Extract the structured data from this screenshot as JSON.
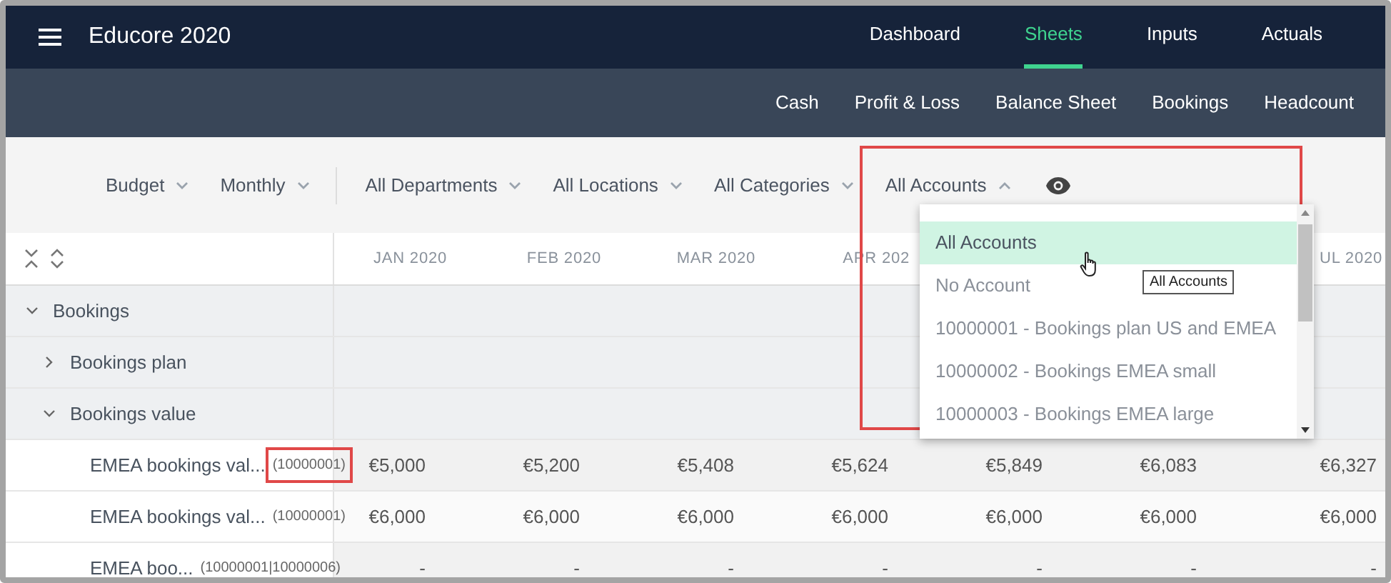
{
  "app": {
    "title": "Educore 2020"
  },
  "nav_tabs": [
    {
      "label": "Dashboard",
      "selected": false
    },
    {
      "label": "Sheets",
      "selected": true
    },
    {
      "label": "Inputs",
      "selected": false
    },
    {
      "label": "Actuals",
      "selected": false
    }
  ],
  "sub_tabs": [
    {
      "label": "Cash",
      "selected": false
    },
    {
      "label": "Profit & Loss",
      "selected": false
    },
    {
      "label": "Balance Sheet",
      "selected": false
    },
    {
      "label": "Bookings",
      "selected": false
    },
    {
      "label": "Headcount",
      "selected": false
    }
  ],
  "filters": [
    {
      "label": "Budget",
      "open": false,
      "highlighted": false
    },
    {
      "label": "Monthly",
      "open": false,
      "highlighted": false
    },
    {
      "label": "All Departments",
      "open": false,
      "highlighted": false
    },
    {
      "label": "All Locations",
      "open": false,
      "highlighted": false
    },
    {
      "label": "All Categories",
      "open": false,
      "highlighted": false
    },
    {
      "label": "All Accounts",
      "open": true,
      "highlighted": true
    }
  ],
  "dropdown": {
    "items": [
      {
        "label": "All Accounts",
        "selected": true
      },
      {
        "label": "No Account",
        "selected": false
      },
      {
        "label": "10000001 - Bookings plan US and EMEA",
        "selected": false
      },
      {
        "label": "10000002 - Bookings EMEA small",
        "selected": false
      },
      {
        "label": "10000003 - Bookings EMEA large",
        "selected": false
      }
    ],
    "tooltip": "All Accounts"
  },
  "table": {
    "columns": [
      {
        "label": "JAN 2020"
      },
      {
        "label": "FEB 2020"
      },
      {
        "label": "MAR 2020"
      },
      {
        "label": "APR 202"
      },
      {},
      {},
      {
        "label": "UL 2020"
      }
    ],
    "rows": [
      {
        "name": "Bookings",
        "expanded": true,
        "children": [
          {
            "name": "Bookings plan",
            "expanded": false
          },
          {
            "name": "Bookings value",
            "expanded": true,
            "children": [
              {
                "name": "EMEA bookings val...",
                "code": "(10000001)",
                "highlighted": true,
                "values": [
                  "€5,000",
                  "€5,200",
                  "€5,408",
                  "€5,624",
                  "€5,849",
                  "€6,083",
                  "€6,327"
                ]
              },
              {
                "name": "EMEA bookings val...",
                "code": "(10000001)",
                "highlighted": false,
                "values": [
                  "€6,000",
                  "€6,000",
                  "€6,000",
                  "€6,000",
                  "€6,000",
                  "€6,000",
                  "€6,000"
                ]
              },
              {
                "name": "EMEA boo...",
                "code": "(10000001|10000006)",
                "highlighted": false,
                "values": [
                  "-",
                  "-",
                  "-",
                  "-",
                  "-",
                  "-",
                  "-"
                ]
              }
            ]
          }
        ]
      }
    ]
  }
}
